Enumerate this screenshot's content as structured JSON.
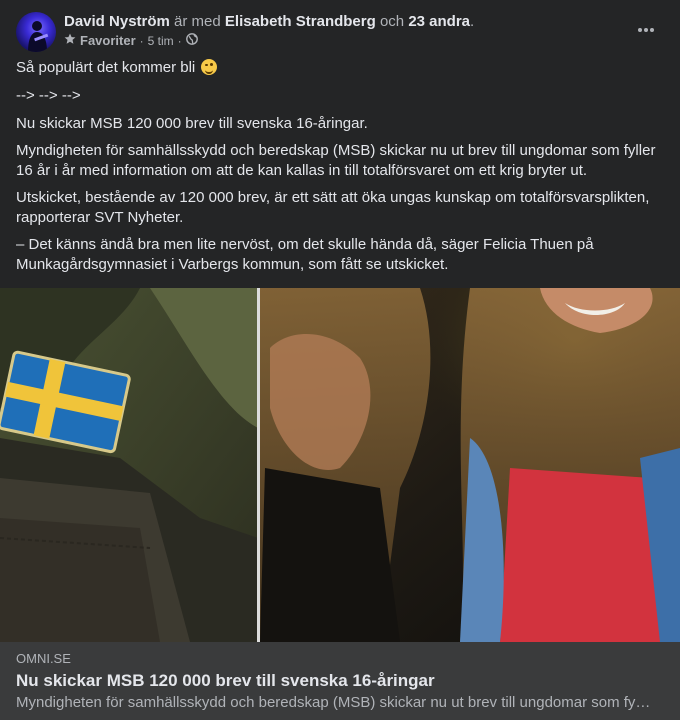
{
  "post": {
    "author": "David Nyström",
    "with_text": "är med",
    "tagged": "Elisabeth Strandberg",
    "and_text": "och",
    "others": "23 andra",
    "end_dot": ".",
    "favorites_label": "Favoriter",
    "separator": "·",
    "time": "5 tim",
    "more_icon": "more-horizontal-icon",
    "text": {
      "line1": "Så populärt det kommer bli",
      "line2": "--> --> -->",
      "line3": "Nu skickar MSB 120 000 brev till svenska 16-åringar.",
      "line4": "Myndigheten för samhällsskydd och beredskap (MSB) skickar nu ut brev till ungdomar som fyller 16 år i år med information om att de kan kallas in till totalförsvaret om ett krig bryter ut.",
      "line5": "Utskicket, bestående av 120 000 brev, är ett sätt att öka ungas kunskap om totalförsvarsplikten, rapporterar SVT Nyheter.",
      "line6": "– Det känns ändå bra men lite nervöst, om det skulle hända då, säger Felicia Thuen på Munkagårdsgymnasiet i Varbergs kommun, som fått se utskicket."
    }
  },
  "link_preview": {
    "domain": "OMNI.SE",
    "title": "Nu skickar MSB 120 000 brev till svenska 16-åringar",
    "description": "Myndigheten för samhällsskydd och beredskap (MSB) skickar nu ut brev till ungdomar som fy…"
  },
  "colors": {
    "background": "#242526",
    "link_background": "#3a3b3c",
    "primary_text": "#e4e6eb",
    "secondary_text": "#b0b3b8"
  }
}
